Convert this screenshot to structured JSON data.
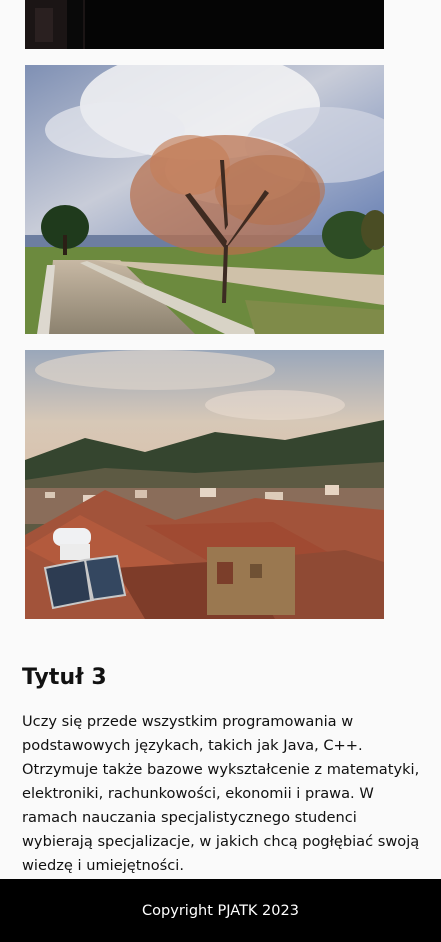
{
  "article": {
    "title": "Tytuł 3",
    "paragraph": "Uczy się przede wszystkim programowania w podstawowych językach, takich jak Java, C++. Otrzymuje także bazowe wykształcenie z matematyki, elektroniki, rachunkowości, ekonomii i prawa. W ramach nauczania specjalistycznego studenci wybierają specjalizacje, w jakich chcą pogłębiać swoją wiedzę i umiejętności."
  },
  "footer": {
    "copyright": "Copyright PJATK 2023"
  }
}
